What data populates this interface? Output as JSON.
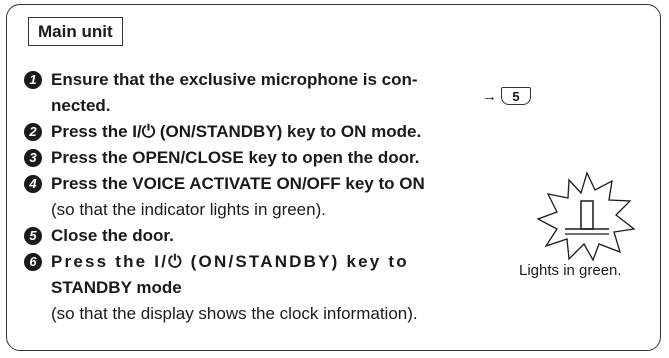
{
  "section_label": "Main unit",
  "steps": [
    {
      "number": "1",
      "line1": "Ensure that the exclusive microphone is con-",
      "line2": "nected."
    },
    {
      "number": "2",
      "text": "Press the I/⏻ (ON/STANDBY) key to ON mode."
    },
    {
      "number": "3",
      "text": "Press the OPEN/CLOSE key to open the door."
    },
    {
      "number": "4",
      "text": "Press the VOICE ACTIVATE ON/OFF key to ON",
      "note": "(so that the indicator lights in green)."
    },
    {
      "number": "5",
      "text": "Close the door."
    },
    {
      "number": "6",
      "line1": "Press the I/⏻ (ON/STANDBY) key to",
      "line2": "STANDBY mode",
      "note": "(so that the display shows the clock information)."
    }
  ],
  "reference": {
    "arrow": "→",
    "page": "5"
  },
  "indicator": {
    "caption": "Lights in green.",
    "icon": "lit-indicator-icon"
  }
}
